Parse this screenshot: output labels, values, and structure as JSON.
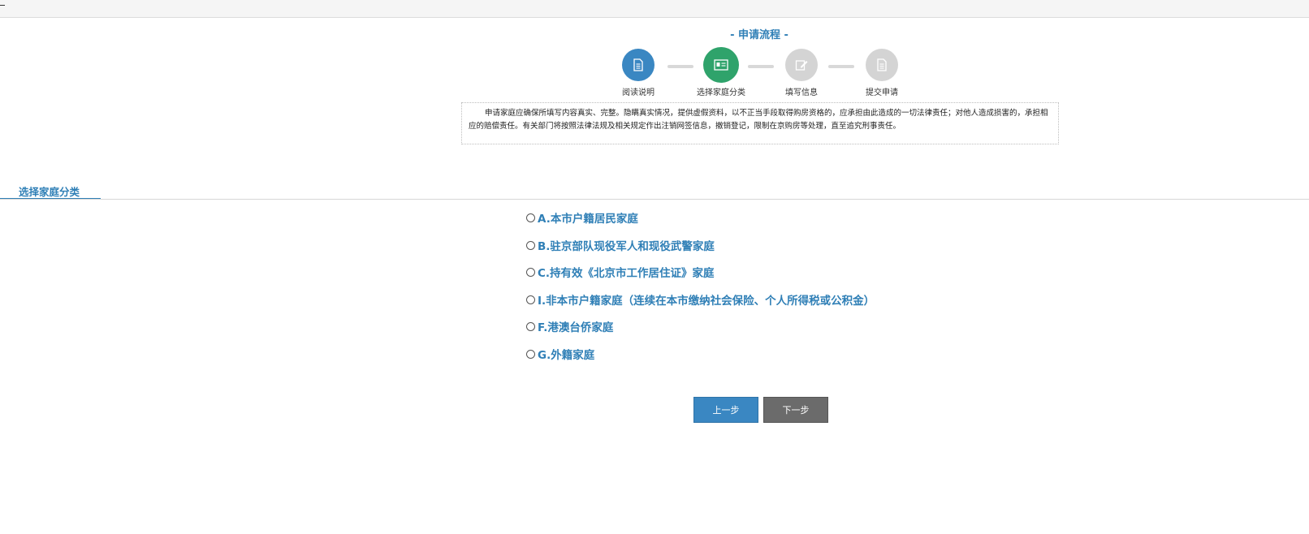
{
  "process": {
    "title": "- 申请流程 -",
    "steps": [
      {
        "label": "阅读说明",
        "icon": "document-icon",
        "state": "completed",
        "color": "#3a87c2"
      },
      {
        "label": "选择家庭分类",
        "icon": "id-card-icon",
        "state": "current",
        "color": "#2fa36b"
      },
      {
        "label": "填写信息",
        "icon": "edit-icon",
        "state": "pending",
        "color": "#d4d4d4"
      },
      {
        "label": "提交申请",
        "icon": "document-icon",
        "state": "pending",
        "color": "#d4d4d4"
      }
    ]
  },
  "notice": {
    "text": "申请家庭应确保所填写内容真实、完整。隐瞒真实情况，提供虚假资料，以不正当手段取得购房资格的，应承担由此造成的一切法律责任；对他人造成损害的，承担相应的赔偿责任。有关部门将按照法律法规及相关规定作出注销网签信息，撤销登记，限制在京购房等处理，直至追究刑事责任。"
  },
  "section": {
    "title": "选择家庭分类"
  },
  "options": [
    {
      "label": "A.本市户籍居民家庭",
      "selected": false
    },
    {
      "label": "B.驻京部队现役军人和现役武警家庭",
      "selected": false
    },
    {
      "label": "C.持有效《北京市工作居住证》家庭",
      "selected": false
    },
    {
      "label": "I.非本市户籍家庭（连续在本市缴纳社会保险、个人所得税或公积金）",
      "selected": false
    },
    {
      "label": "F.港澳台侨家庭",
      "selected": false
    },
    {
      "label": "G.外籍家庭",
      "selected": false
    }
  ],
  "buttons": {
    "prev_label": "上一步",
    "next_label": "下一步"
  },
  "colors": {
    "accent": "#2f7fb6",
    "step_done": "#3a87c2",
    "step_current": "#2fa36b",
    "step_pending": "#d4d4d4",
    "button_next": "#6b6b6b"
  }
}
